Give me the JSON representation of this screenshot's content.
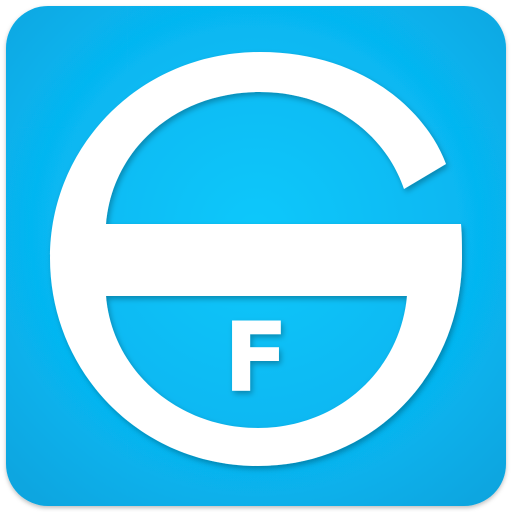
{
  "icon": {
    "name": "app-icon-g-f-logo",
    "logo_letter": "F",
    "glyph": "G",
    "colors": {
      "background_center": "#07c2f7",
      "background_edge": "#0aa8e3",
      "glyph": "#ffffff",
      "outer_background": "#ffffff"
    }
  }
}
